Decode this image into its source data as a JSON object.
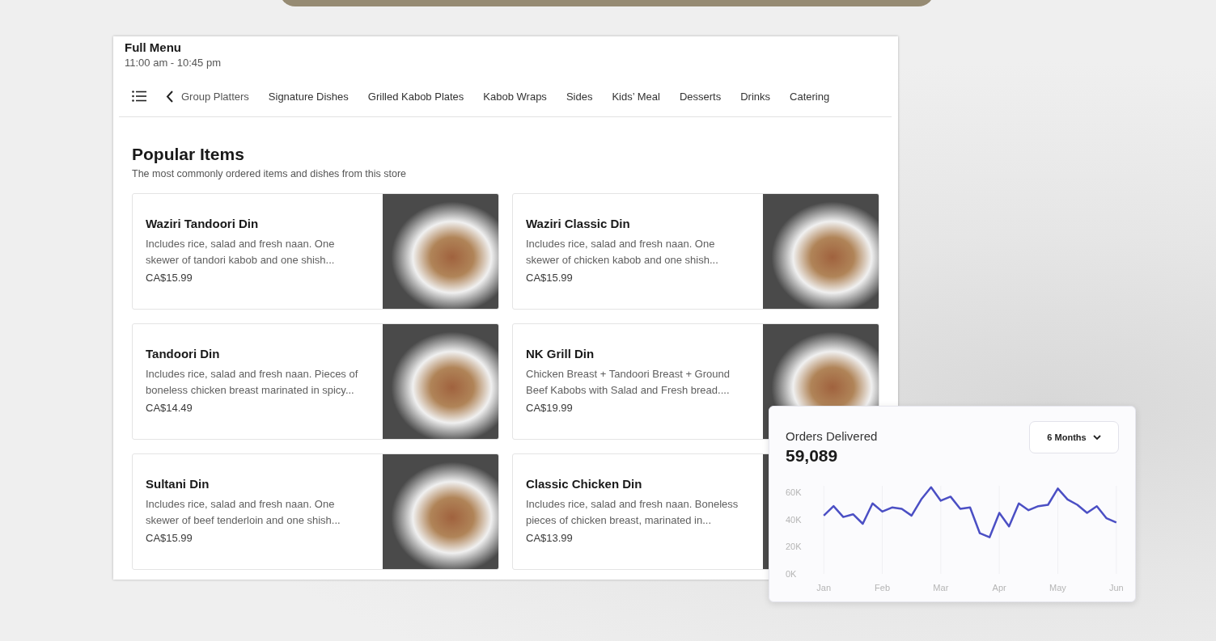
{
  "menu": {
    "title": "Full Menu",
    "hours": "11:00 am - 10:45 pm",
    "categories": [
      "Group Platters",
      "Signature Dishes",
      "Grilled Kabob Plates",
      "Kabob Wraps",
      "Sides",
      "Kids’ Meal",
      "Desserts",
      "Drinks",
      "Catering"
    ]
  },
  "popular": {
    "heading": "Popular Items",
    "subtitle": "The most commonly ordered items and dishes from this store",
    "items": [
      {
        "name": "Waziri Tandoori Din",
        "description": "Includes rice, salad and fresh naan. One skewer of tandori kabob and one shish...",
        "price": "CA$15.99"
      },
      {
        "name": "Waziri Classic Din",
        "description": "Includes rice, salad and fresh naan. One skewer of chicken kabob and one shish...",
        "price": "CA$15.99"
      },
      {
        "name": "Tandoori Din",
        "description": "Includes rice, salad and fresh naan. Pieces of boneless chicken breast marinated in spicy...",
        "price": "CA$14.49"
      },
      {
        "name": "NK Grill Din",
        "description": "Chicken Breast + Tandoori Breast + Ground Beef Kabobs with Salad and Fresh bread....",
        "price": "CA$19.99"
      },
      {
        "name": "Sultani Din",
        "description": "Includes rice, salad and fresh naan. One skewer of beef tenderloin and one shish...",
        "price": "CA$15.99"
      },
      {
        "name": "Classic Chicken Din",
        "description": "Includes rice, salad and fresh naan. Boneless pieces of chicken breast, marinated in...",
        "price": "CA$13.99"
      }
    ]
  },
  "orders_card": {
    "title": "Orders Delivered",
    "total": "59,089",
    "period": "6 Months",
    "chart_data": {
      "type": "line",
      "categories": [
        "Jan",
        null,
        null,
        null,
        null,
        null,
        "Feb",
        null,
        null,
        null,
        null,
        null,
        "Mar",
        null,
        null,
        null,
        null,
        null,
        "Apr",
        null,
        null,
        null,
        null,
        null,
        "May",
        null,
        null,
        null,
        null,
        null,
        "Jun"
      ],
      "series": [
        {
          "color": "#4b4fc4",
          "values": [
            43000,
            50000,
            42000,
            44000,
            37000,
            52000,
            46000,
            49000,
            48000,
            43000,
            55000,
            64000,
            54000,
            57000,
            48000,
            49000,
            30000,
            27000,
            45000,
            35000,
            52000,
            47000,
            50000,
            51000,
            63000,
            55000,
            51000,
            45000,
            50000,
            41000,
            38000
          ]
        }
      ],
      "ylim": [
        0,
        65000
      ],
      "grid": true,
      "yticks": [
        {
          "value": 0,
          "label": "0K"
        },
        {
          "value": 20000,
          "label": "20K"
        },
        {
          "value": 40000,
          "label": "40K"
        },
        {
          "value": 60000,
          "label": "60K"
        }
      ]
    }
  }
}
